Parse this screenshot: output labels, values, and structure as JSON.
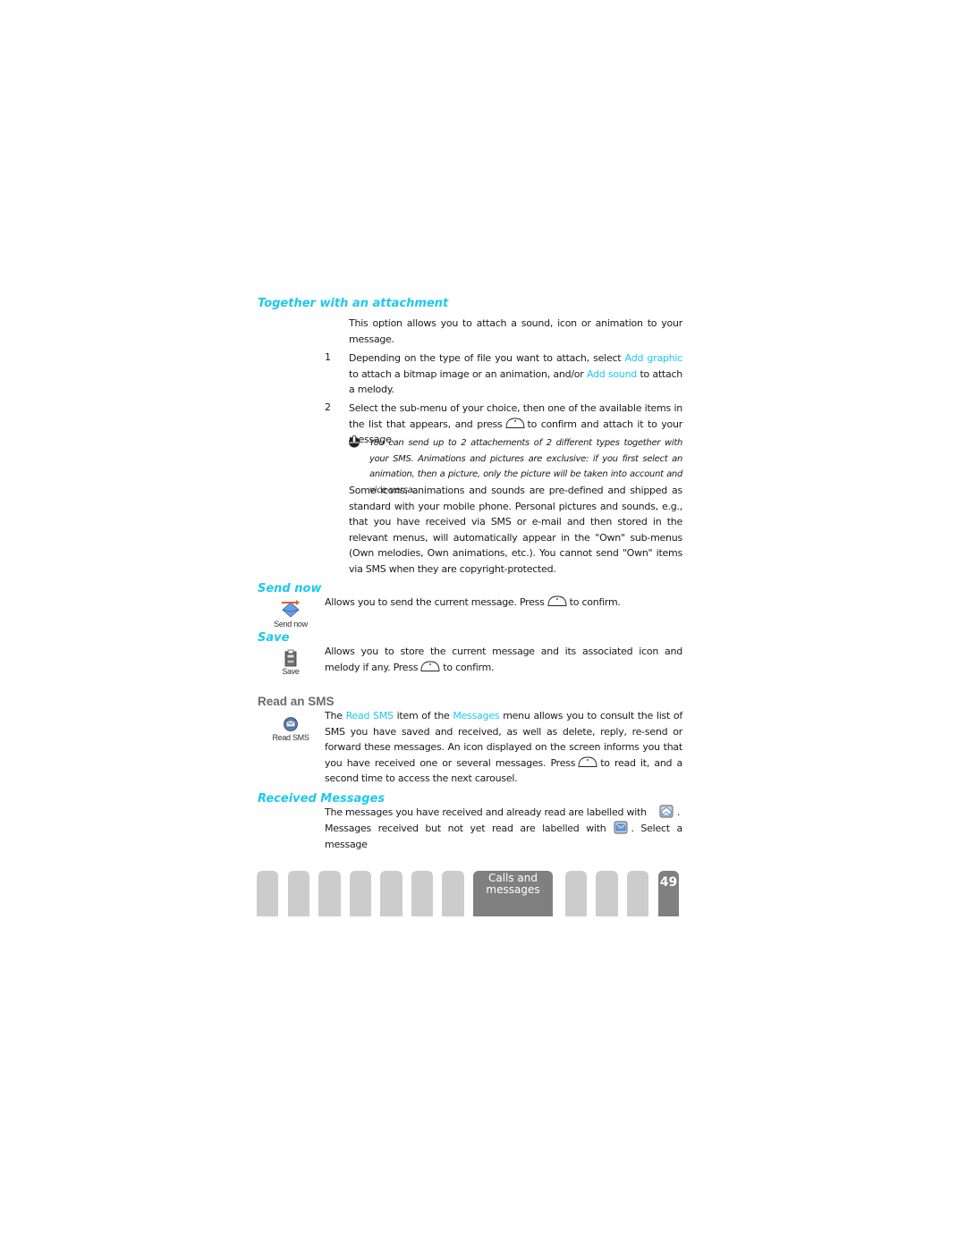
{
  "sections": {
    "attachment": {
      "heading": "Together with an attachment",
      "intro": "This option allows you to attach a sound, icon or animation to your message.",
      "steps": [
        {
          "number": "1",
          "text_a": "Depending on the type of file you want to attach, select ",
          "link_a": "Add graphic",
          "text_b": " to attach a bitmap image or an animation, and/or ",
          "link_b": "Add sound",
          "text_c": " to attach a melody."
        },
        {
          "number": "2",
          "text_a": "Select the sub-menu of your choice, then one of the available items in the list that appears, and press",
          "text_b": "to confirm and attach it to your message."
        }
      ],
      "note": "You can send up to 2 attachements of 2 different types together with your SMS. Animations and pictures are exclusive: if you first select an animation, then a picture, only the picture will be taken into account and vice-versa.",
      "extra": "Some icons, animations and sounds are pre-defined and shipped as standard with your mobile phone. Personal pictures and sounds, e.g., that you have received via SMS or e-mail and then stored in the relevant menus, will automatically appear in the \"Own\" sub-menus (Own melodies, Own animations, etc.). You cannot send \"Own\" items via SMS when they are copyright-protected."
    },
    "send_now": {
      "heading": "Send now",
      "icon_label": "Send now",
      "text_a": "Allows you to send the current message. Press",
      "text_b": "to confirm."
    },
    "save": {
      "heading": "Save",
      "icon_label": "Save",
      "text_a": "Allows you to store the current message and its associated icon and melody if any. Press",
      "text_b": "to confirm."
    },
    "read_sms": {
      "heading": "Read an SMS",
      "icon_label": "Read SMS",
      "text_a": "The ",
      "link_a": "Read SMS",
      "text_b": " item of the ",
      "link_b": "Messages",
      "text_c": " menu allows you to consult the list of SMS you have saved and received, as well as delete, reply, re-send or forward these messages. An icon displayed on the screen informs you that you have received one or several messages. Press",
      "text_d": "to read it, and a second time to access the next carousel."
    },
    "received": {
      "heading": "Received Messages",
      "line1_a": "The messages you have received and already read are labelled with",
      "line1_b": ".",
      "line2_a": "Messages received but not yet read are labelled with",
      "line2_b": ". Select a message"
    }
  },
  "footer": {
    "active_tab_label_1": "Calls and",
    "active_tab_label_2": "messages",
    "page_number": "49",
    "tab_count_before": 7,
    "tab_count_after": 3
  },
  "icons": {
    "ok_key": "ok-key-icon",
    "note": "hand-note-icon",
    "send_now": "send-envelope-icon",
    "save": "filing-cabinet-icon",
    "read_sms": "read-sms-icon",
    "read_msg": "read-envelope-icon",
    "unread_msg": "unread-envelope-icon"
  },
  "colors": {
    "accent": "#1ec8ee",
    "tab_inactive": "#cccccc",
    "tab_active": "#808080"
  }
}
